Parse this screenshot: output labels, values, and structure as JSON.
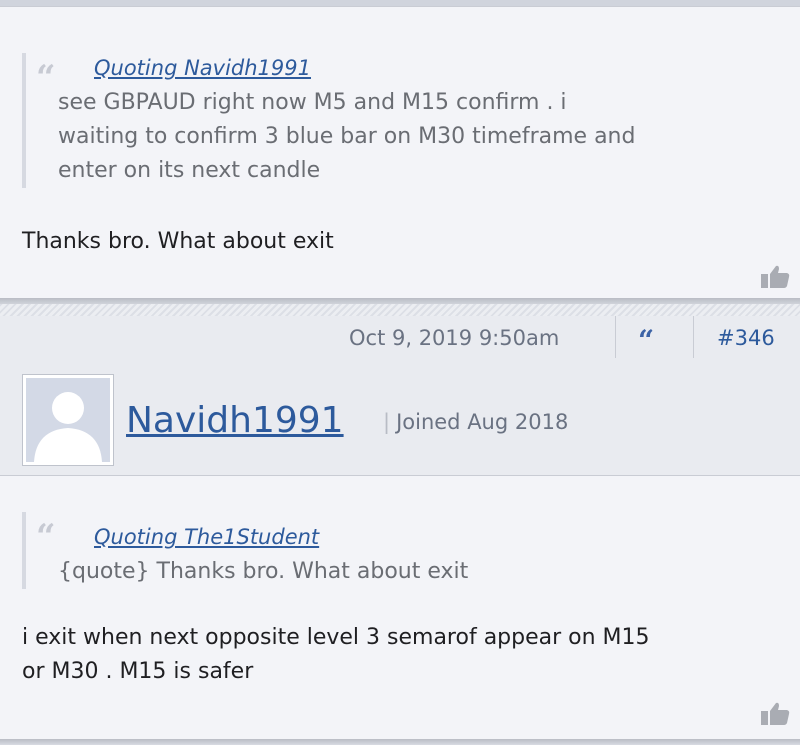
{
  "post1": {
    "quote": {
      "author": "Quoting Navidh1991",
      "lines": [
        "see GBPAUD right now M5 and M15 confirm . i",
        "waiting to confirm 3 blue bar on M30 timeframe and",
        "enter on its next candle"
      ]
    },
    "text": "Thanks bro. What about exit"
  },
  "post2": {
    "date": "Oct 9, 2019 9:50am",
    "number": "#346",
    "username": "Navidh1991",
    "joined_separator": "|",
    "joined": "Joined Aug 2018",
    "quote": {
      "author": "Quoting The1Student",
      "text": "{quote} Thanks bro. What about exit"
    },
    "text_lines": [
      "i exit when next opposite level 3 semarof appear on M15",
      "or M30 . M15 is safer"
    ]
  },
  "icons": {
    "quote_mark": "“",
    "like": "thumbs-up-icon",
    "avatar": "default-avatar-icon"
  },
  "colors": {
    "link": "#2d5a9c",
    "quote_text": "#6a6d73",
    "meta_text": "#6a7282"
  }
}
